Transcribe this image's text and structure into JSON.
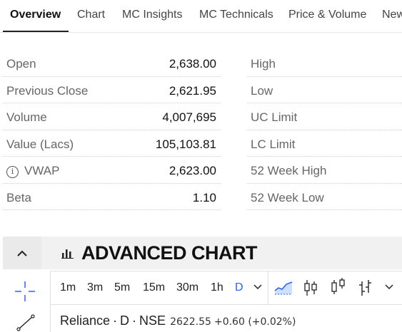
{
  "tabs": [
    "Overview",
    "Chart",
    "MC Insights",
    "MC Technicals",
    "Price & Volume",
    "New"
  ],
  "stats_left": [
    {
      "label": "Open",
      "value": "2,638.00"
    },
    {
      "label": "Previous Close",
      "value": "2,621.95"
    },
    {
      "label": "Volume",
      "value": "4,007,695"
    },
    {
      "label": "Value (Lacs)",
      "value": "105,103.81"
    },
    {
      "label": "VWAP",
      "value": "2,623.00"
    },
    {
      "label": "Beta",
      "value": "1.10"
    }
  ],
  "stats_right": [
    {
      "label": "High"
    },
    {
      "label": "Low"
    },
    {
      "label": "UC Limit"
    },
    {
      "label": "LC Limit"
    },
    {
      "label": "52 Week High"
    },
    {
      "label": "52 Week Low"
    }
  ],
  "advanced_chart": {
    "title": "ADVANCED CHART",
    "timeframes": [
      "1m",
      "3m",
      "5m",
      "15m",
      "30m",
      "1h",
      "D"
    ],
    "active_timeframe": "D",
    "symbol": "Reliance",
    "interval": "D",
    "exchange": "NSE",
    "price": "2622.55",
    "change": "+0.60 (+0.02%)"
  },
  "colors": {
    "accent": "#2962ff",
    "text": "#222222",
    "muted": "#666666"
  },
  "icons": [
    "info-icon",
    "chevron-up-icon",
    "bar-chart-icon",
    "crosshair-icon",
    "trend-line-icon",
    "area-chart-icon",
    "candlestick-icon",
    "hollow-candle-icon",
    "ohlc-bars-icon",
    "chevron-down-icon"
  ]
}
